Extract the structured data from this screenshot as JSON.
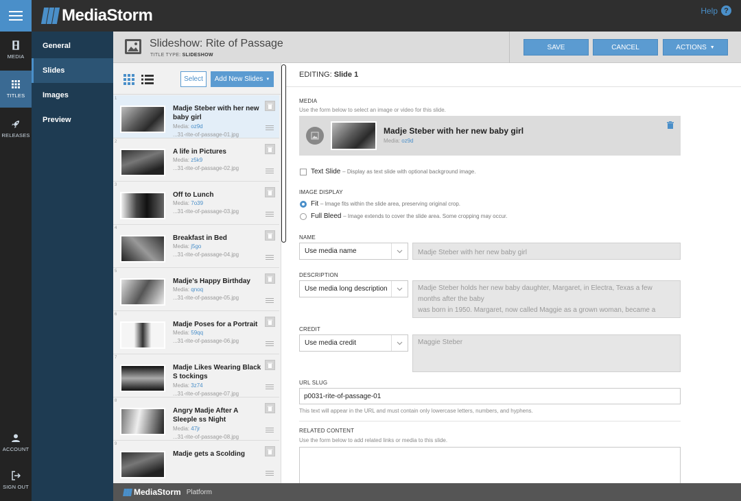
{
  "app": {
    "brand": "MediaStorm",
    "help_label": "Help",
    "accent": "#4a8fc9"
  },
  "rail": [
    {
      "label": "MEDIA",
      "icon": "film-icon"
    },
    {
      "label": "TITLES",
      "icon": "grid-icon"
    },
    {
      "label": "RELEASES",
      "icon": "rocket-icon"
    },
    {
      "label": "ACCOUNT",
      "icon": "user-icon"
    },
    {
      "label": "SIGN OUT",
      "icon": "sign-out-icon"
    }
  ],
  "subnav": [
    "General",
    "Slides",
    "Images",
    "Preview"
  ],
  "header": {
    "title": "Slideshow: Rite of Passage",
    "type_prefix": "TITLE TYPE:",
    "type_value": "SLIDESHOW",
    "save": "SAVE",
    "cancel": "CANCEL",
    "actions": "ACTIONS"
  },
  "list": {
    "select": "Select",
    "add": "Add New Slides",
    "media_prefix": "Media:",
    "slides": [
      {
        "num": "1",
        "title": "Madje Steber with her new baby girl",
        "media": "oz9d",
        "file": "...31-rite-of-passage-01.jpg"
      },
      {
        "num": "2",
        "title": "A life in Pictures",
        "media": "z5k9",
        "file": "...31-rite-of-passage-02.jpg"
      },
      {
        "num": "3",
        "title": "Off to Lunch",
        "media": "7o39",
        "file": "...31-rite-of-passage-03.jpg"
      },
      {
        "num": "4",
        "title": "Breakfast in Bed",
        "media": "j5go",
        "file": "...31-rite-of-passage-04.jpg"
      },
      {
        "num": "5",
        "title": "Madje's Happy Birthday",
        "media": "qnoq",
        "file": "...31-rite-of-passage-05.jpg"
      },
      {
        "num": "6",
        "title": "Madje Poses for a Portrait",
        "media": "59qq",
        "file": "...31-rite-of-passage-06.jpg"
      },
      {
        "num": "7",
        "title": "Madje Likes Wearing Black S tockings",
        "media": "3z74",
        "file": "...31-rite-of-passage-07.jpg"
      },
      {
        "num": "8",
        "title": "Angry Madje After A Sleeple ss Night",
        "media": "47jr",
        "file": "...31-rite-of-passage-08.jpg"
      },
      {
        "num": "9",
        "title": "Madje gets a Scolding",
        "media": "",
        "file": ""
      }
    ]
  },
  "editor": {
    "editing_prefix": "EDITING:",
    "editing_target": "Slide 1",
    "media_label": "MEDIA",
    "media_help": "Use the form below to select an image or video for this slide.",
    "media_name": "Madje Steber with her new baby girl",
    "media_prefix": "Media:",
    "media_id": "oz9d",
    "text_slide_label": "Text Slide",
    "text_slide_help": "– Display as text slide with optional background image.",
    "image_display_label": "IMAGE DISPLAY",
    "fit_label": "Fit",
    "fit_help": "– Image fits within the slide area, preserving original crop.",
    "bleed_label": "Full Bleed",
    "bleed_help": "– Image extends to cover the slide area. Some cropping may occur.",
    "name_label": "NAME",
    "name_select": "Use media name",
    "name_value": "Madje Steber with her new baby girl",
    "desc_label": "DESCRIPTION",
    "desc_select": "Use media long description",
    "desc_value": "Madje Steber holds her new baby daughter, Margaret, in Electra, Texas a few months after the baby\nwas born in 1950. Margaret, now called Maggie as a grown woman, became a",
    "credit_label": "CREDIT",
    "credit_select": "Use media credit",
    "credit_value": "Maggie Steber",
    "slug_label": "URL SLUG",
    "slug_value": "p0031-rite-of-passage-01",
    "slug_help": "This text will appear in the URL and must contain only lowercase letters, numbers, and hyphens.",
    "related_label": "RELATED CONTENT",
    "related_help": "Use the form below to add related links or media to this slide."
  },
  "footer": {
    "brand": "MediaStorm",
    "product": "Platform"
  }
}
